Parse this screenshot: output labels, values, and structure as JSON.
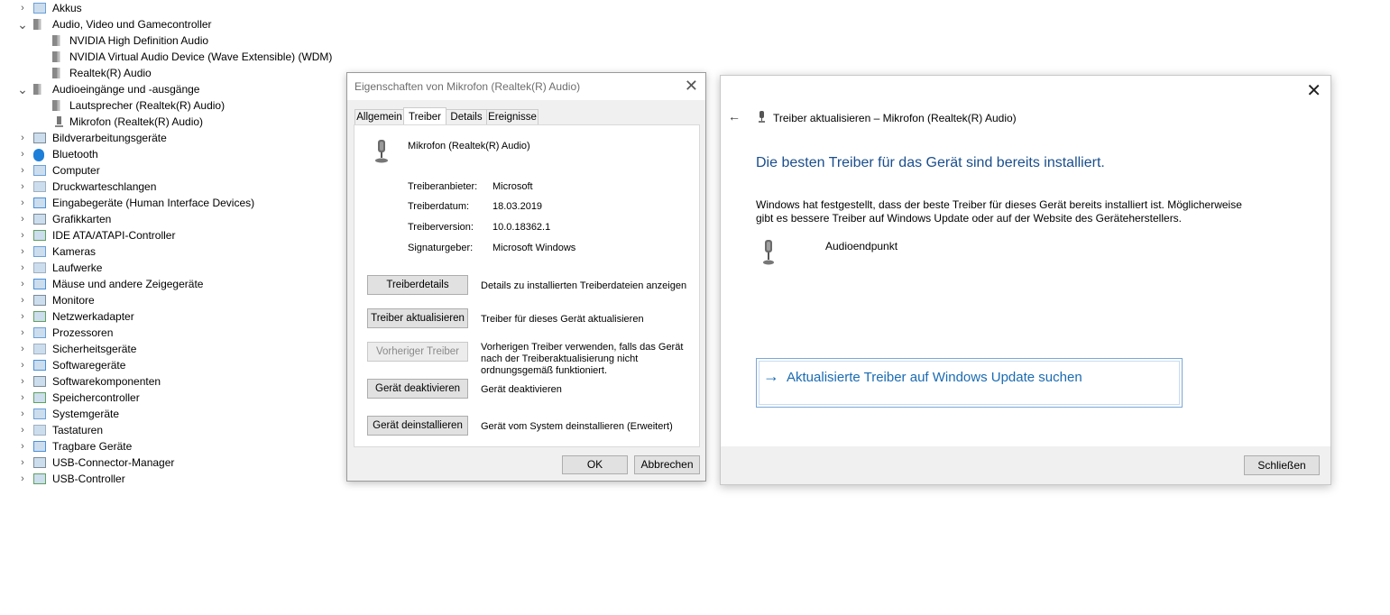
{
  "tree": {
    "items": [
      {
        "label": "Akkus",
        "expanded": false,
        "icon": "battery-icon"
      },
      {
        "label": "Audio, Video und Gamecontroller",
        "expanded": true,
        "icon": "speaker-icon"
      },
      {
        "label": "NVIDIA High Definition Audio",
        "child": true,
        "icon": "speaker-icon"
      },
      {
        "label": "NVIDIA Virtual Audio Device (Wave Extensible) (WDM)",
        "child": true,
        "icon": "speaker-icon"
      },
      {
        "label": "Realtek(R) Audio",
        "child": true,
        "icon": "speaker-icon"
      },
      {
        "label": "Audioeingänge und -ausgänge",
        "expanded": true,
        "icon": "speaker-icon"
      },
      {
        "label": "Lautsprecher (Realtek(R) Audio)",
        "child": true,
        "icon": "speaker-icon"
      },
      {
        "label": "Mikrofon (Realtek(R) Audio)",
        "child": true,
        "icon": "microphone-icon"
      },
      {
        "label": "Bildverarbeitungsgeräte",
        "expanded": false,
        "icon": "camera-icon"
      },
      {
        "label": "Bluetooth",
        "expanded": false,
        "icon": "bluetooth-icon"
      },
      {
        "label": "Computer",
        "expanded": false,
        "icon": "monitor-icon"
      },
      {
        "label": "Druckwarteschlangen",
        "expanded": false,
        "icon": "printer-icon"
      },
      {
        "label": "Eingabegeräte (Human Interface Devices)",
        "expanded": false,
        "icon": "hid-icon"
      },
      {
        "label": "Grafikkarten",
        "expanded": false,
        "icon": "display-adapter-icon"
      },
      {
        "label": "IDE ATA/ATAPI-Controller",
        "expanded": false,
        "icon": "ide-controller-icon"
      },
      {
        "label": "Kameras",
        "expanded": false,
        "icon": "webcam-icon"
      },
      {
        "label": "Laufwerke",
        "expanded": false,
        "icon": "drive-icon"
      },
      {
        "label": "Mäuse und andere Zeigegeräte",
        "expanded": false,
        "icon": "mouse-icon"
      },
      {
        "label": "Monitore",
        "expanded": false,
        "icon": "monitor-icon"
      },
      {
        "label": "Netzwerkadapter",
        "expanded": false,
        "icon": "network-adapter-icon"
      },
      {
        "label": "Prozessoren",
        "expanded": false,
        "icon": "processor-icon"
      },
      {
        "label": "Sicherheitsgeräte",
        "expanded": false,
        "icon": "security-key-icon"
      },
      {
        "label": "Softwaregeräte",
        "expanded": false,
        "icon": "software-device-icon"
      },
      {
        "label": "Softwarekomponenten",
        "expanded": false,
        "icon": "software-component-icon"
      },
      {
        "label": "Speichercontroller",
        "expanded": false,
        "icon": "storage-controller-icon"
      },
      {
        "label": "Systemgeräte",
        "expanded": false,
        "icon": "system-device-icon"
      },
      {
        "label": "Tastaturen",
        "expanded": false,
        "icon": "keyboard-icon"
      },
      {
        "label": "Tragbare Geräte",
        "expanded": false,
        "icon": "portable-device-icon"
      },
      {
        "label": "USB-Connector-Manager",
        "expanded": false,
        "icon": "usb-icon"
      },
      {
        "label": "USB-Controller",
        "expanded": false,
        "icon": "usb-icon"
      }
    ]
  },
  "props": {
    "title": "Eigenschaften von Mikrofon (Realtek(R) Audio)",
    "tabs": [
      "Allgemein",
      "Treiber",
      "Details",
      "Ereignisse"
    ],
    "active_tab": "Treiber",
    "device_name": "Mikrofon (Realtek(R) Audio)",
    "fields": [
      {
        "key": "Treiberanbieter:",
        "value": "Microsoft"
      },
      {
        "key": "Treiberdatum:",
        "value": "18.03.2019"
      },
      {
        "key": "Treiberversion:",
        "value": "10.0.18362.1"
      },
      {
        "key": "Signaturgeber:",
        "value": "Microsoft Windows"
      }
    ],
    "actions": [
      {
        "button": "Treiberdetails",
        "desc": "Details zu installierten Treiberdateien anzeigen",
        "disabled": false
      },
      {
        "button": "Treiber aktualisieren",
        "desc": "Treiber für dieses Gerät aktualisieren",
        "disabled": false
      },
      {
        "button": "Vorheriger Treiber",
        "desc": "Vorherigen Treiber verwenden, falls das Gerät nach der Treiberaktualisierung nicht ordnungsgemäß funktioniert.",
        "disabled": true
      },
      {
        "button": "Gerät deaktivieren",
        "desc": "Gerät deaktivieren",
        "disabled": false
      },
      {
        "button": "Gerät deinstallieren",
        "desc": "Gerät vom System deinstallieren (Erweitert)",
        "disabled": false
      }
    ],
    "ok_label": "OK",
    "cancel_label": "Abbrechen"
  },
  "update": {
    "header": "Treiber aktualisieren – Mikrofon (Realtek(R) Audio)",
    "heading": "Die besten Treiber für das Gerät sind bereits installiert.",
    "paragraph": "Windows hat festgestellt, dass der beste Treiber für dieses Gerät bereits installiert ist. Möglicherweise gibt es bessere Treiber auf Windows Update oder auf der Website des Geräteherstellers.",
    "device_label": "Audioendpunkt",
    "link_arrow": "→",
    "link_label": "Aktualisierte Treiber auf Windows Update suchen",
    "close_label": "Schließen",
    "accent": "#1a4e8c"
  }
}
